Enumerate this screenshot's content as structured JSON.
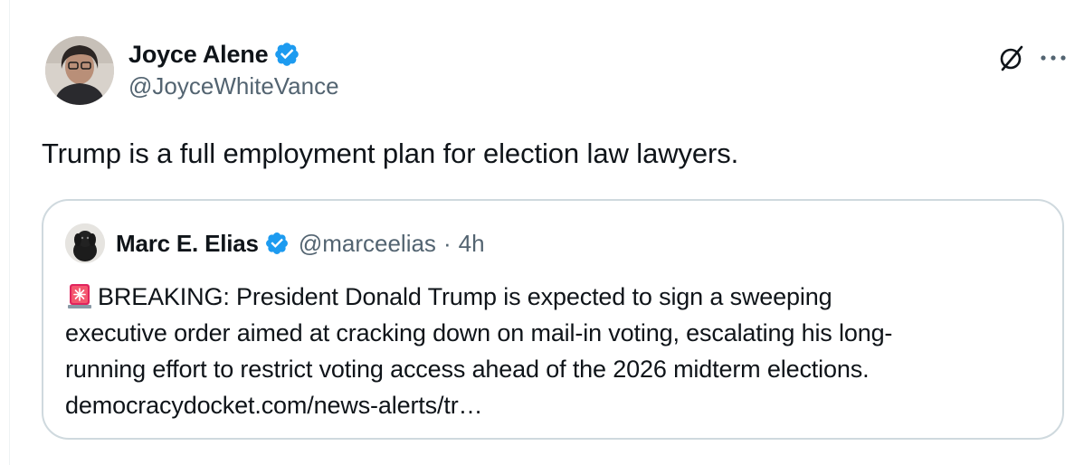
{
  "tweet": {
    "author": {
      "display_name": "Joyce Alene",
      "handle": "@JoyceWhiteVance",
      "verified": true
    },
    "text": "Trump is a full employment plan for election law lawyers.",
    "actions": {
      "grok_icon": "grok-slash-icon",
      "more_icon": "more-dots-icon"
    }
  },
  "quote": {
    "author": {
      "display_name": "Marc E. Elias",
      "handle": "@marceelias",
      "separator": "·",
      "time": "4h",
      "verified": true
    },
    "lead_icon": "siren-emoji-icon",
    "lines": [
      "BREAKING: President Donald Trump is expected to sign a sweeping",
      "executive order aimed at cracking down on mail-in voting, escalating his long-",
      "running effort to restrict voting access ahead of the 2026 midterm elections.",
      "democracydocket.com/news-alerts/tr…"
    ]
  },
  "colors": {
    "verified_blue": "#1d9bf0",
    "secondary_text": "#536471",
    "border": "#cfd9de",
    "siren_red": "#e0245e"
  }
}
